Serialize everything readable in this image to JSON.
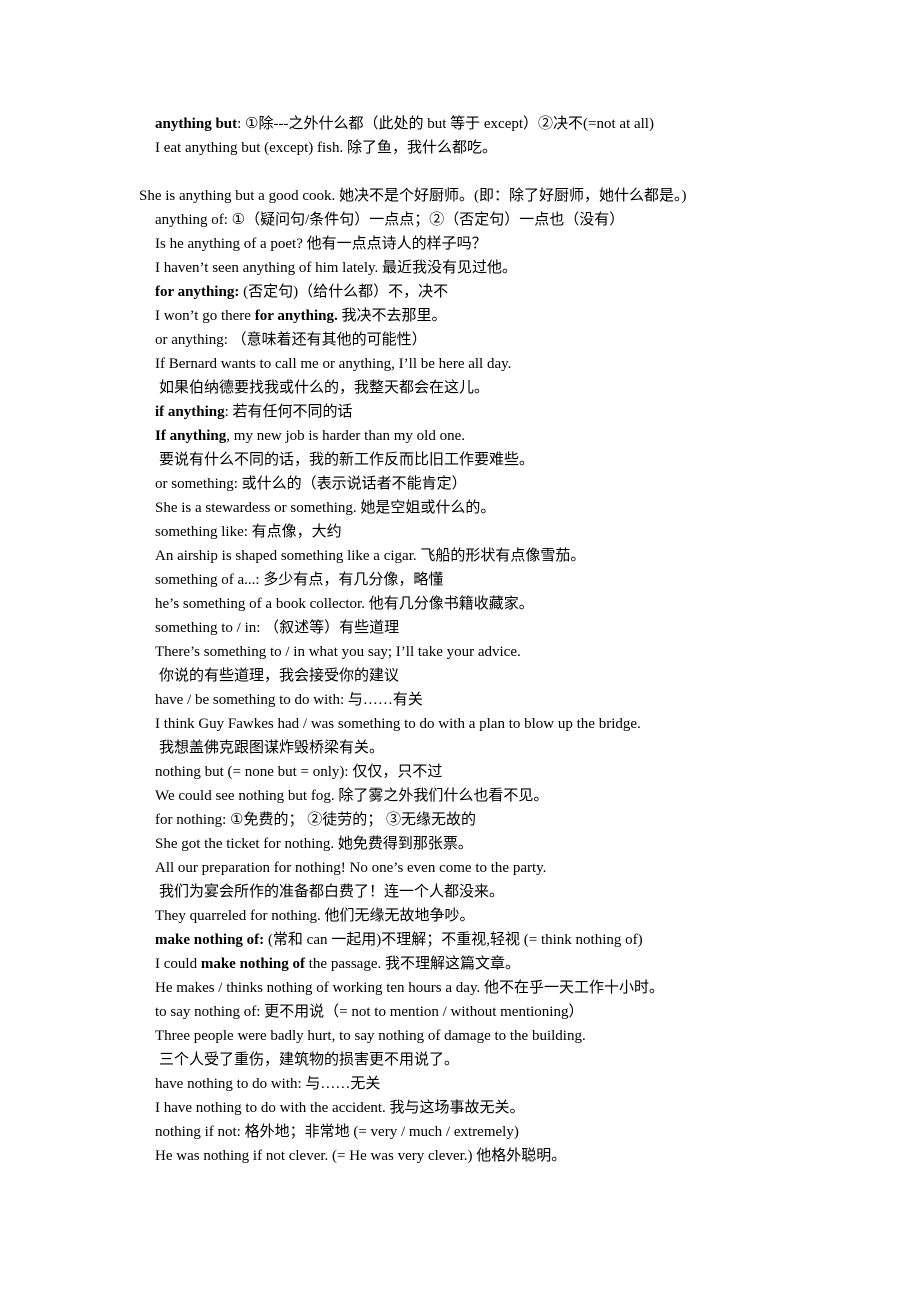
{
  "document": {
    "lines": [
      {
        "parts": [
          {
            "t": "anything but",
            "b": true
          },
          {
            "t": ": ①除---之外什么都（此处的 but 等于 except）②决不(=not at all)"
          }
        ]
      },
      {
        "parts": [
          {
            "t": "I eat anything but (except) fish.  除了鱼，我什么都吃。"
          }
        ]
      },
      {
        "parts": [
          {
            "t": "She is anything but a good cook.  她决不是个好厨师。(即：除了好厨师，她什么都是。)"
          }
        ]
      },
      {
        "parts": [
          {
            "t": "anything of: ①（疑问句/条件句）一点点；②（否定句）一点也（没有）"
          }
        ]
      },
      {
        "parts": [
          {
            "t": "Is he anything of a poet?  他有一点点诗人的样子吗？"
          }
        ]
      },
      {
        "parts": [
          {
            "t": "I haven’t seen anything of him lately.  最近我没有见过他。"
          }
        ]
      },
      {
        "parts": [
          {
            "t": "for anything:",
            "b": true
          },
          {
            "t": " (否定句)（给什么都）不，决不"
          }
        ]
      },
      {
        "parts": [
          {
            "t": "I won’t go there "
          },
          {
            "t": "for anything.",
            "b": true
          },
          {
            "t": "  我决不去那里。"
          }
        ]
      },
      {
        "parts": [
          {
            "t": "or anything:  （意味着还有其他的可能性）"
          }
        ]
      },
      {
        "parts": [
          {
            "t": "If Bernard wants to call me or anything, I’ll be here all day."
          }
        ]
      },
      {
        "parts": [
          {
            "t": "如果伯纳德要找我或什么的，我整天都会在这儿。"
          }
        ]
      },
      {
        "parts": [
          {
            "t": "if anything",
            "b": true
          },
          {
            "t": ":  若有任何不同的话"
          }
        ]
      },
      {
        "parts": [
          {
            "t": "If anything",
            "b": true
          },
          {
            "t": ", my new job is harder than my old one."
          }
        ]
      },
      {
        "parts": [
          {
            "t": "要说有什么不同的话，我的新工作反而比旧工作要难些。"
          }
        ]
      },
      {
        "parts": [
          {
            "t": "or something:  或什么的（表示说话者不能肯定）"
          }
        ]
      },
      {
        "parts": [
          {
            "t": "She is a stewardess or something.  她是空姐或什么的。"
          }
        ]
      },
      {
        "parts": [
          {
            "t": "something like:  有点像，大约"
          }
        ]
      },
      {
        "parts": [
          {
            "t": "An airship is shaped something like a cigar.  飞船的形状有点像雪茄。"
          }
        ]
      },
      {
        "parts": [
          {
            "t": "something of a...:  多少有点，有几分像，略懂"
          }
        ]
      },
      {
        "parts": [
          {
            "t": "he’s something of a book collector.  他有几分像书籍收藏家。"
          }
        ]
      },
      {
        "parts": [
          {
            "t": "something to / in:  （叙述等）有些道理"
          }
        ]
      },
      {
        "parts": [
          {
            "t": "There’s something to / in what you say; I’ll take your advice."
          }
        ]
      },
      {
        "parts": [
          {
            "t": "你说的有些道理，我会接受你的建议"
          }
        ]
      },
      {
        "parts": [
          {
            "t": "have / be something to do with:  与……有关"
          }
        ]
      },
      {
        "parts": [
          {
            "t": "I think Guy Fawkes had / was something to do with a plan to blow up the bridge."
          }
        ]
      },
      {
        "parts": [
          {
            "t": "我想盖佛克跟图谋炸毁桥梁有关。"
          }
        ]
      },
      {
        "parts": [
          {
            "t": "nothing but (= none but = only):  仅仅，只不过"
          }
        ]
      },
      {
        "parts": [
          {
            "t": "We could see nothing but fog.  除了雾之外我们什么也看不见。"
          }
        ]
      },
      {
        "parts": [
          {
            "t": "for nothing: ①免费的；  ②徒劳的；  ③无缘无故的"
          }
        ]
      },
      {
        "parts": [
          {
            "t": "She got the ticket for nothing.  她免费得到那张票。"
          }
        ]
      },
      {
        "parts": [
          {
            "t": "All our preparation for nothing! No one’s even come to the party."
          }
        ]
      },
      {
        "parts": [
          {
            "t": "我们为宴会所作的准备都白费了！连一个人都没来。"
          }
        ]
      },
      {
        "parts": [
          {
            "t": "They quarreled for nothing.  他们无缘无故地争吵。"
          }
        ]
      },
      {
        "parts": [
          {
            "t": "make nothing of:",
            "b": true
          },
          {
            "t": " (常和 can 一起用)不理解；不重视,轻视  (= think nothing of)"
          }
        ]
      },
      {
        "parts": [
          {
            "t": "I could "
          },
          {
            "t": "make nothing of",
            "b": true
          },
          {
            "t": " the passage.  我不理解这篇文章。"
          }
        ]
      },
      {
        "parts": [
          {
            "t": "He makes / thinks nothing of working ten hours a day.  他不在乎一天工作十小时。"
          }
        ]
      },
      {
        "parts": [
          {
            "t": "to say nothing of:  更不用说（= not to mention / without mentioning）"
          }
        ]
      },
      {
        "parts": [
          {
            "t": "Three people were badly hurt, to say nothing of damage to the building."
          }
        ]
      },
      {
        "parts": [
          {
            "t": "三个人受了重伤，建筑物的损害更不用说了。"
          }
        ]
      },
      {
        "parts": [
          {
            "t": "have nothing to do with:  与……无关"
          }
        ]
      },
      {
        "parts": [
          {
            "t": "I have nothing to do with the accident.  我与这场事故无关。"
          }
        ]
      },
      {
        "parts": [
          {
            "t": "nothing if not:  格外地；非常地  (= very / much / extremely)"
          }
        ]
      },
      {
        "parts": [
          {
            "t": "He was nothing if not clever. (= He was very clever.)  他格外聪明。"
          }
        ]
      }
    ]
  }
}
